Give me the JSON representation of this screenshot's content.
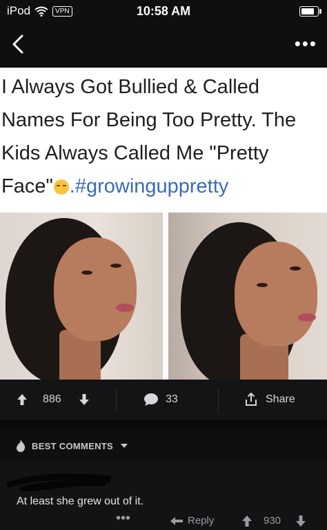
{
  "status_bar": {
    "carrier": "iPod",
    "vpn": "VPN",
    "time": "10:58 AM",
    "battery_level": 0.9
  },
  "post": {
    "meme_line_1": "I Always Got Bullied & Called",
    "meme_line_2": "Names For Being Too Pretty. The",
    "meme_line_3": "Kids Always Called Me \"Pretty",
    "meme_line_4_prefix": "Face\"",
    "meme_line_4_sep": ".",
    "hashtag": "#growinguppretty",
    "emoji": "crying-face-emoji"
  },
  "actions": {
    "upvotes": "886",
    "comments": "33",
    "share": "Share"
  },
  "sort": {
    "label": "BEST COMMENTS"
  },
  "comment": {
    "body": "At least she grew out of it.",
    "more": "•••",
    "reply": "Reply",
    "score": "930"
  },
  "colors": {
    "background": "#111214",
    "hashtag": "#3a6bb5",
    "action_text": "#d6d7da"
  },
  "icons": [
    "back-chevron-icon",
    "more-dots-icon",
    "wifi-icon",
    "battery-icon",
    "upvote-arrow-icon",
    "downvote-arrow-icon",
    "comment-bubble-icon",
    "share-icon",
    "flame-icon",
    "caret-down-icon",
    "reply-arrow-icon"
  ]
}
